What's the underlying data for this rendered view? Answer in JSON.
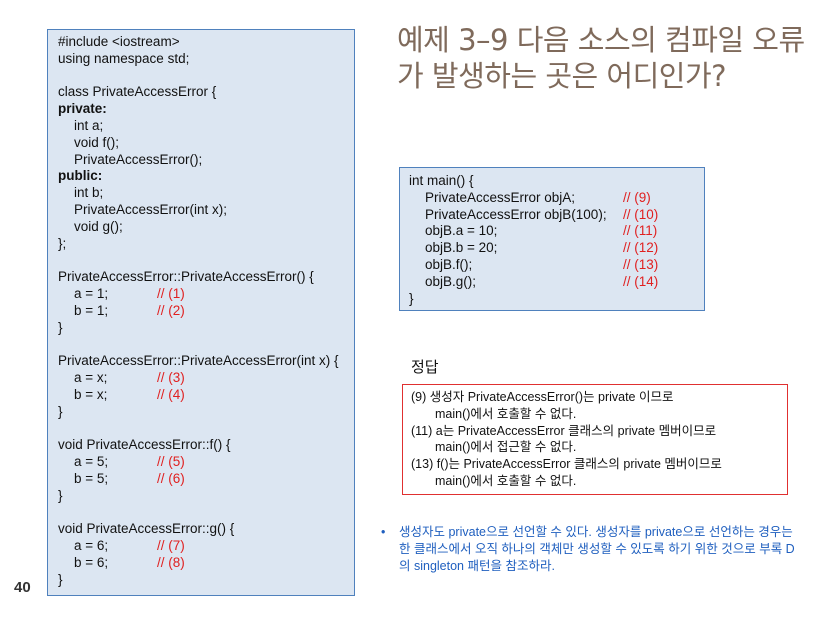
{
  "title": "예제 3–9 다음 소스의 컴파일 오류가 발생하는 곳은 어디인가?",
  "page_number": "40",
  "left_code": [
    {
      "text": "#include <iostream>"
    },
    {
      "text": "using namespace std;"
    },
    {
      "text": ""
    },
    {
      "text": "class PrivateAccessError {"
    },
    {
      "text": "private:",
      "bold": true
    },
    {
      "text": "int a;",
      "indent": true
    },
    {
      "text": "void f();",
      "indent": true
    },
    {
      "text": "PrivateAccessError();",
      "indent": true
    },
    {
      "text": "public:",
      "bold": true
    },
    {
      "text": "int b;",
      "indent": true
    },
    {
      "text": "PrivateAccessError(int x);",
      "indent": true
    },
    {
      "text": "void g();",
      "indent": true
    },
    {
      "text": "};"
    },
    {
      "text": ""
    },
    {
      "text": "PrivateAccessError::PrivateAccessError() {"
    },
    {
      "text": "a = 1;",
      "indent": true,
      "comment": "// (1)"
    },
    {
      "text": "b = 1;",
      "indent": true,
      "comment": "// (2)"
    },
    {
      "text": "}"
    },
    {
      "text": ""
    },
    {
      "text": "PrivateAccessError::PrivateAccessError(int x) {"
    },
    {
      "text": "a = x;",
      "indent": true,
      "comment": "// (3)"
    },
    {
      "text": "b = x;",
      "indent": true,
      "comment": "// (4)"
    },
    {
      "text": "}"
    },
    {
      "text": ""
    },
    {
      "text": "void PrivateAccessError::f() {"
    },
    {
      "text": "a = 5;",
      "indent": true,
      "comment": "// (5)"
    },
    {
      "text": "b = 5;",
      "indent": true,
      "comment": "// (6)"
    },
    {
      "text": "}"
    },
    {
      "text": ""
    },
    {
      "text": "void PrivateAccessError::g() {"
    },
    {
      "text": "a = 6;",
      "indent": true,
      "comment": "// (7)"
    },
    {
      "text": "b = 6;",
      "indent": true,
      "comment": "// (8)"
    },
    {
      "text": "}"
    }
  ],
  "main_code": [
    {
      "text": "int main() {"
    },
    {
      "text": "PrivateAccessError objA;",
      "indent": true,
      "comment": "// (9)"
    },
    {
      "text": "PrivateAccessError objB(100);",
      "indent": true,
      "comment": "// (10)"
    },
    {
      "text": "objB.a = 10;",
      "indent": true,
      "comment": "// (11)"
    },
    {
      "text": "objB.b = 20;",
      "indent": true,
      "comment": "// (12)"
    },
    {
      "text": "objB.f();",
      "indent": true,
      "comment": "// (13)"
    },
    {
      "text": "objB.g();",
      "indent": true,
      "comment": "// (14)"
    },
    {
      "text": "}"
    }
  ],
  "answer": {
    "heading": "정답",
    "lines": [
      {
        "text": "(9) 생성자 PrivateAccessError()는 private 이므로"
      },
      {
        "text": "main()에서 호출할 수 없다.",
        "cont": true
      },
      {
        "text": "(11) a는 PrivateAccessError 클래스의 private 멤버이므로"
      },
      {
        "text": "main()에서 접근할 수 없다.",
        "cont": true
      },
      {
        "text": "(13) f()는 PrivateAccessError 클래스의 private 멤버이므로"
      },
      {
        "text": "main()에서 호출할 수 없다.",
        "cont": true
      }
    ]
  },
  "note": {
    "bullet": "•",
    "text": "생성자도 private으로 선언할 수 있다. 생성자를 private으로 선언하는 경우는 한 클래스에서 오직 하나의 객체만 생성할 수 있도록 하기 위한 것으로 부록 D의 singleton 패턴을 참조하라."
  },
  "colors": {
    "code_bg": "#dce6f2",
    "code_border": "#4f81bd",
    "comment": "#e02020",
    "title": "#7f6a5b",
    "answer_border": "#e03030",
    "note": "#1f5fbf"
  }
}
